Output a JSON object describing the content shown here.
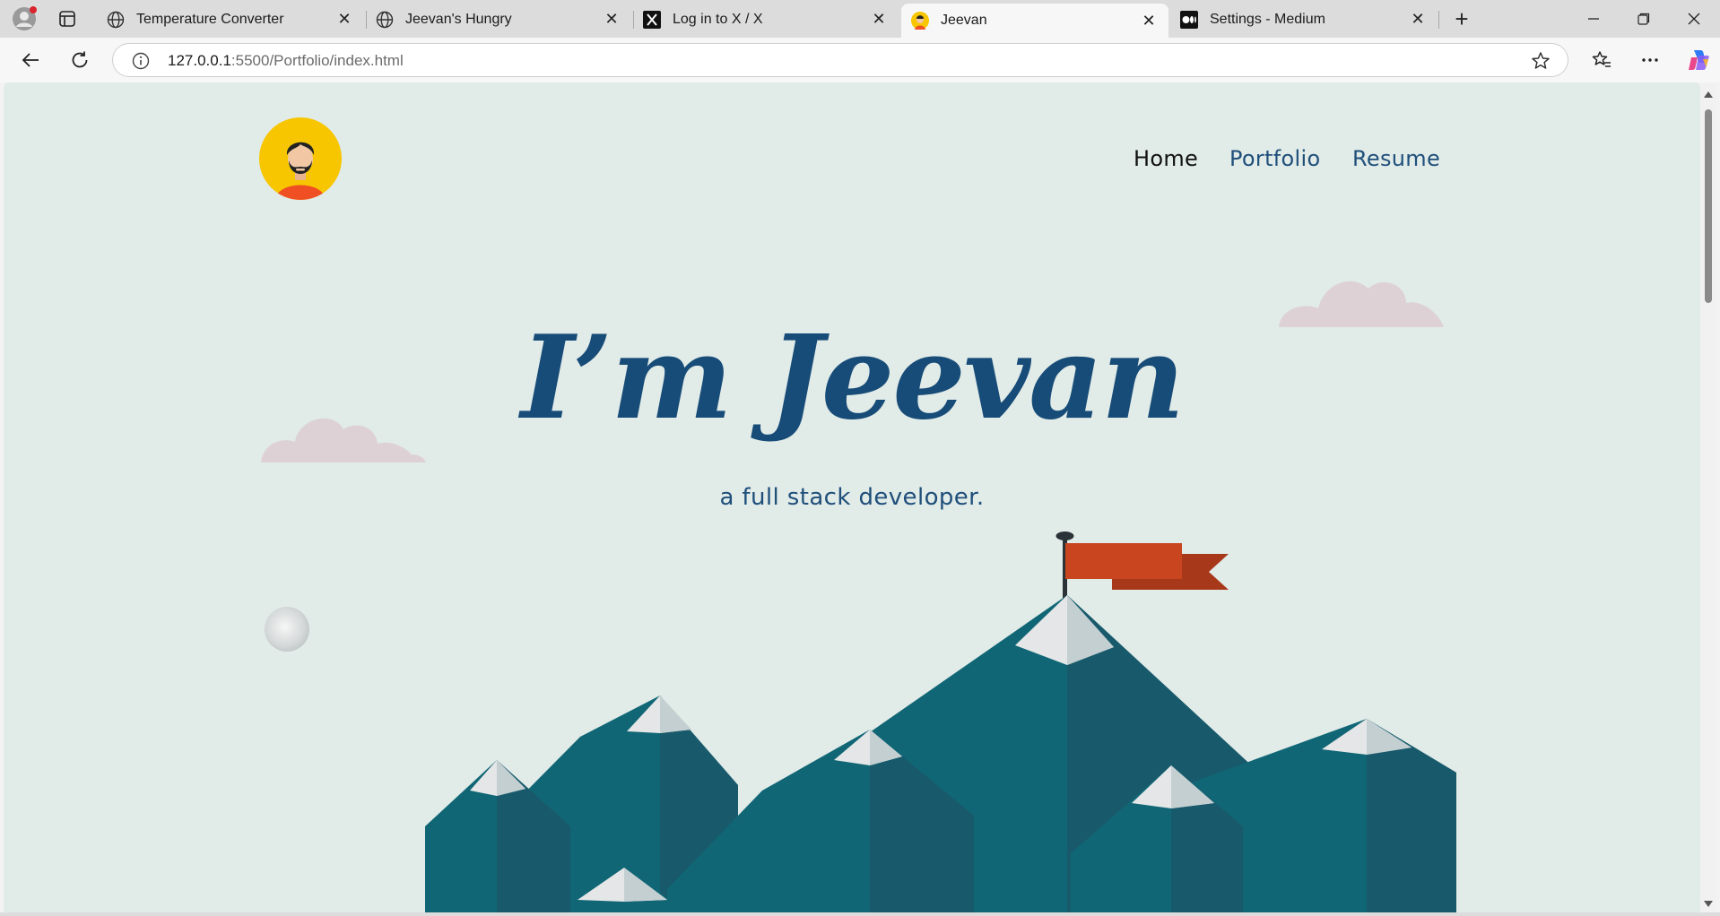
{
  "browser": {
    "tabs": [
      {
        "title": "Temperature Converter",
        "icon": "globe-icon",
        "active": false
      },
      {
        "title": "Jeevan's Hungry",
        "icon": "globe-icon",
        "active": false
      },
      {
        "title": "Log in to X / X",
        "icon": "x-logo-icon",
        "active": false
      },
      {
        "title": "Jeevan",
        "icon": "avatar-favicon-icon",
        "active": true
      },
      {
        "title": "Settings - Medium",
        "icon": "medium-logo-icon",
        "active": false
      }
    ],
    "close_glyph": "✕",
    "new_tab_glyph": "+",
    "address": {
      "host": "127.0.0.1",
      "path": ":5500/Portfolio/index.html"
    }
  },
  "page": {
    "nav": {
      "home": "Home",
      "portfolio": "Portfolio",
      "resume": "Resume"
    },
    "hero": {
      "title": "I’m Jeevan",
      "subtitle": "a full stack developer."
    }
  },
  "colors": {
    "page_bg": "#e1ebe8",
    "title": "#174c78",
    "nav_link": "#1f4f7a",
    "mountain_dark": "#185a6b",
    "mountain_light": "#106675",
    "flag": "#c8451f",
    "cloud": "#ddd1d6",
    "logo_bg": "#f7c600"
  }
}
